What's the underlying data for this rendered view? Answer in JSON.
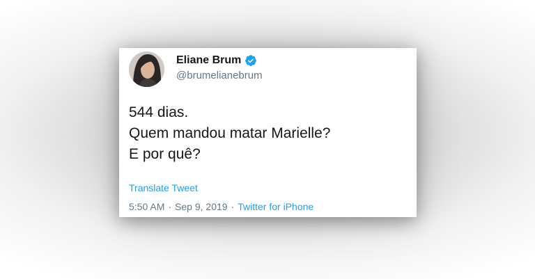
{
  "tweet": {
    "author": {
      "display_name": "Eliane Brum",
      "handle": "@brumelianebrum",
      "verified_icon": "verified-badge-icon"
    },
    "text_lines": [
      "544 dias.",
      "Quem mandou matar Marielle?",
      "E por quê?"
    ],
    "translate_label": "Translate Tweet",
    "time": "5:50 AM",
    "separator": "·",
    "date": "Sep 9, 2019",
    "source": "Twitter for iPhone"
  },
  "colors": {
    "link": "#1da1f2",
    "secondary_text": "#657786",
    "primary_text": "#14171a",
    "verified": "#1da1f2"
  }
}
